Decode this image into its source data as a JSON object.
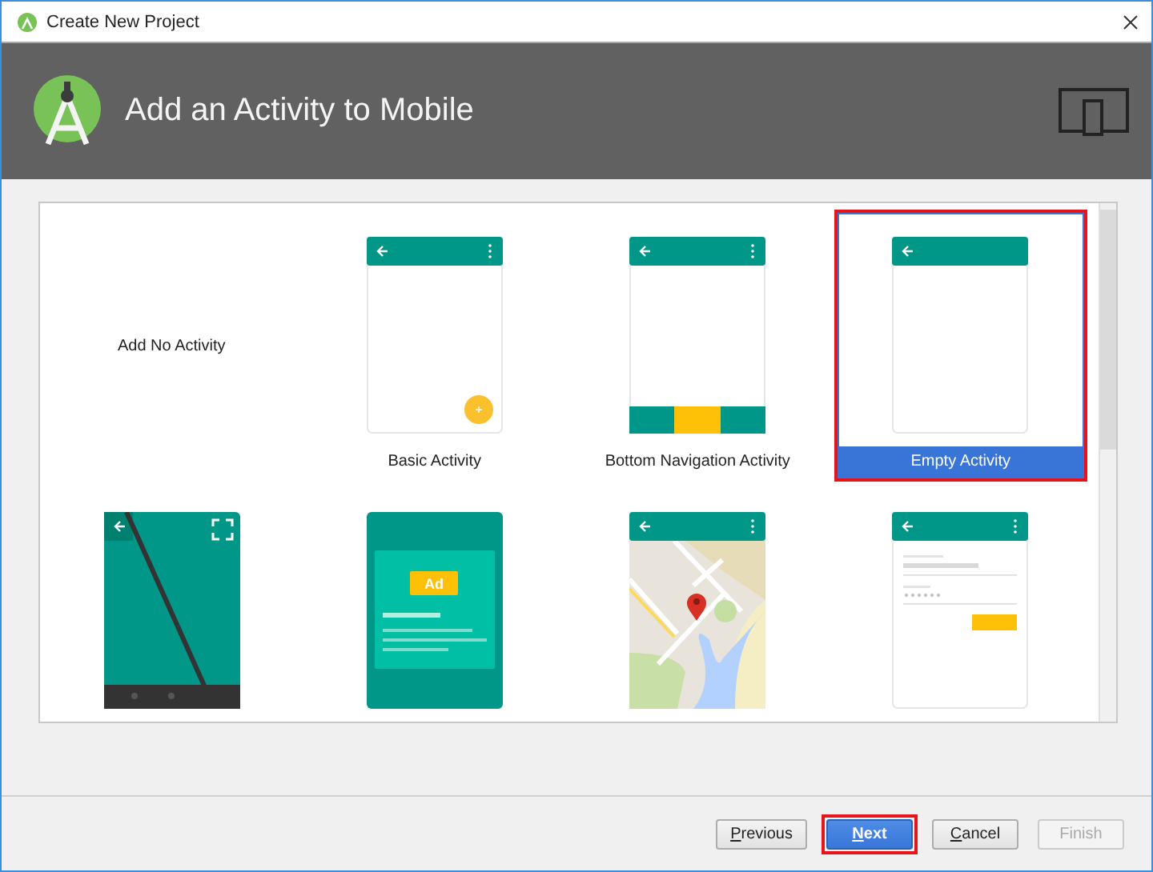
{
  "window": {
    "title": "Create New Project"
  },
  "header": {
    "title": "Add an Activity to Mobile"
  },
  "templates": [
    {
      "kind": "none",
      "label": "Add No Activity",
      "selected": false,
      "highlighted": false
    },
    {
      "kind": "basic",
      "label": "Basic Activity",
      "selected": false,
      "highlighted": false
    },
    {
      "kind": "bottom_nav",
      "label": "Bottom Navigation Activity",
      "selected": false,
      "highlighted": false
    },
    {
      "kind": "empty",
      "label": "Empty Activity",
      "selected": true,
      "highlighted": true
    },
    {
      "kind": "fullscreen",
      "selected": false,
      "highlighted": false
    },
    {
      "kind": "admob",
      "badge": "Ad",
      "selected": false,
      "highlighted": false
    },
    {
      "kind": "maps",
      "selected": false,
      "highlighted": false
    },
    {
      "kind": "login",
      "selected": false,
      "highlighted": false
    }
  ],
  "buttons": [
    {
      "label": "Previous",
      "mnemonic": true,
      "default": false,
      "disabled": false,
      "highlighted": false
    },
    {
      "label": "Next",
      "mnemonic": true,
      "default": true,
      "disabled": false,
      "highlighted": true
    },
    {
      "label": "Cancel",
      "mnemonic": true,
      "default": false,
      "disabled": false,
      "highlighted": false
    },
    {
      "label": "Finish",
      "mnemonic": false,
      "default": false,
      "disabled": true,
      "highlighted": false
    }
  ]
}
